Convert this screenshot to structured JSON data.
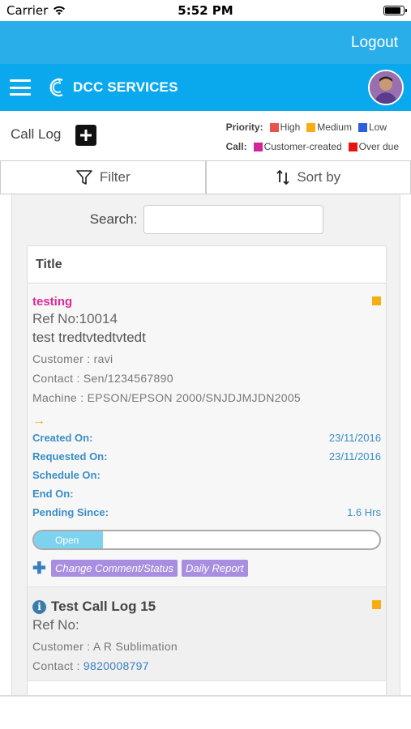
{
  "status_bar": {
    "carrier": "Carrier",
    "time": "5:52 PM"
  },
  "top_bar": {
    "logout_label": "Logout"
  },
  "nav": {
    "brand_name": "DCC SERVICES"
  },
  "header": {
    "title": "Call Log",
    "priority_label": "Priority:",
    "priority_items": [
      {
        "label": "High",
        "color": "#e8534e"
      },
      {
        "label": "Medium",
        "color": "#f6ae14"
      },
      {
        "label": "Low",
        "color": "#2b5fe0"
      }
    ],
    "call_label": "Call:",
    "call_items": [
      {
        "label": "Customer-created",
        "color": "#d4259a"
      },
      {
        "label": "Over due",
        "color": "#e81212"
      }
    ]
  },
  "toolbar": {
    "filter_label": "Filter",
    "sort_label": "Sort by"
  },
  "search": {
    "label": "Search:",
    "value": ""
  },
  "list": {
    "header": "Title",
    "items": [
      {
        "title": "testing",
        "ref": "Ref No:10014",
        "description": "test tredtvtedtvtedt",
        "customer": "Customer : ravi",
        "contact": "Contact : Sen/1234567890",
        "machine": "Machine : EPSON/EPSON 2000/SNJDJMJDN2005",
        "arrow": "→",
        "created_label": "Created On:",
        "created_value": "23/11/2016",
        "requested_label": "Requested On:",
        "requested_value": "23/11/2016",
        "schedule_label": "Schedule On:",
        "end_label": "End On:",
        "pending_label": "Pending Since:",
        "pending_value": "1.6 Hrs",
        "status": "Open",
        "progress": 0.2,
        "action_change": "Change Comment/Status",
        "action_report": "Daily Report"
      },
      {
        "title": "Test Call Log 15",
        "ref": "Ref No:",
        "customer": "Customer : A R Sublimation",
        "contact_label": "Contact : ",
        "contact_phone": "9820008797"
      }
    ]
  }
}
